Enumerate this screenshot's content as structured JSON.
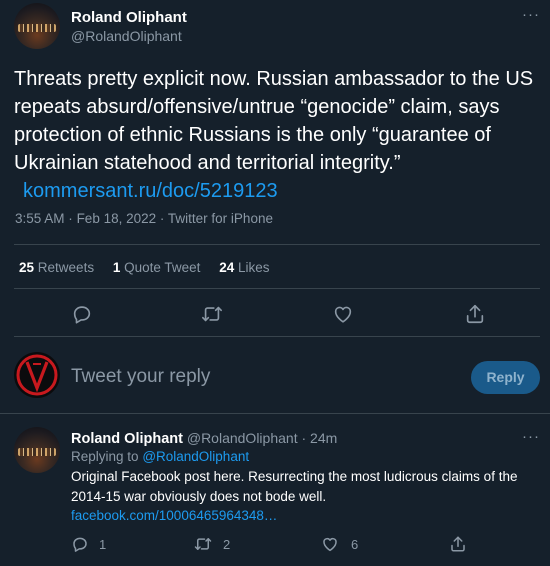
{
  "tweet": {
    "author_name": "Roland Oliphant",
    "author_handle": "@RolandOliphant",
    "text": "Threats pretty explicit now. Russian ambassador to the US repeats absurd/offensive/untrue “genocide” claim, says protection of ethnic Russians is the only “guarantee of Ukrainian statehood and territorial integrity.”",
    "link": "kommersant.ru/doc/5219123",
    "time": "3:55 AM",
    "date": "Feb 18, 2022",
    "source": "Twitter for iPhone",
    "separator": "·",
    "more": "···"
  },
  "stats": {
    "retweets_count": "25",
    "retweets_label": "Retweets",
    "quotes_count": "1",
    "quotes_label": "Quote Tweet",
    "likes_count": "24",
    "likes_label": "Likes"
  },
  "icons": {
    "reply": "reply-icon",
    "retweet": "retweet-icon",
    "like": "heart-icon",
    "share": "share-icon"
  },
  "composer": {
    "placeholder": "Tweet your reply",
    "button_label": "Reply"
  },
  "reply": {
    "author_name": "Roland Oliphant",
    "author_handle": "@RolandOliphant",
    "separator": "·",
    "age": "24m",
    "replying_to_prefix": "Replying to",
    "replying_to_handle": "@RolandOliphant",
    "text": "Original Facebook post here. Resurrecting the most ludicrous claims of the 2014-15 war obviously does not bode well.",
    "link": "facebook.com/10006465964348…",
    "reply_count": "1",
    "retweet_count": "2",
    "like_count": "6",
    "more": "···"
  },
  "colors": {
    "background": "#15202b",
    "accent": "#1d9bf0",
    "muted": "#8b98a5",
    "divider": "#38444d"
  }
}
